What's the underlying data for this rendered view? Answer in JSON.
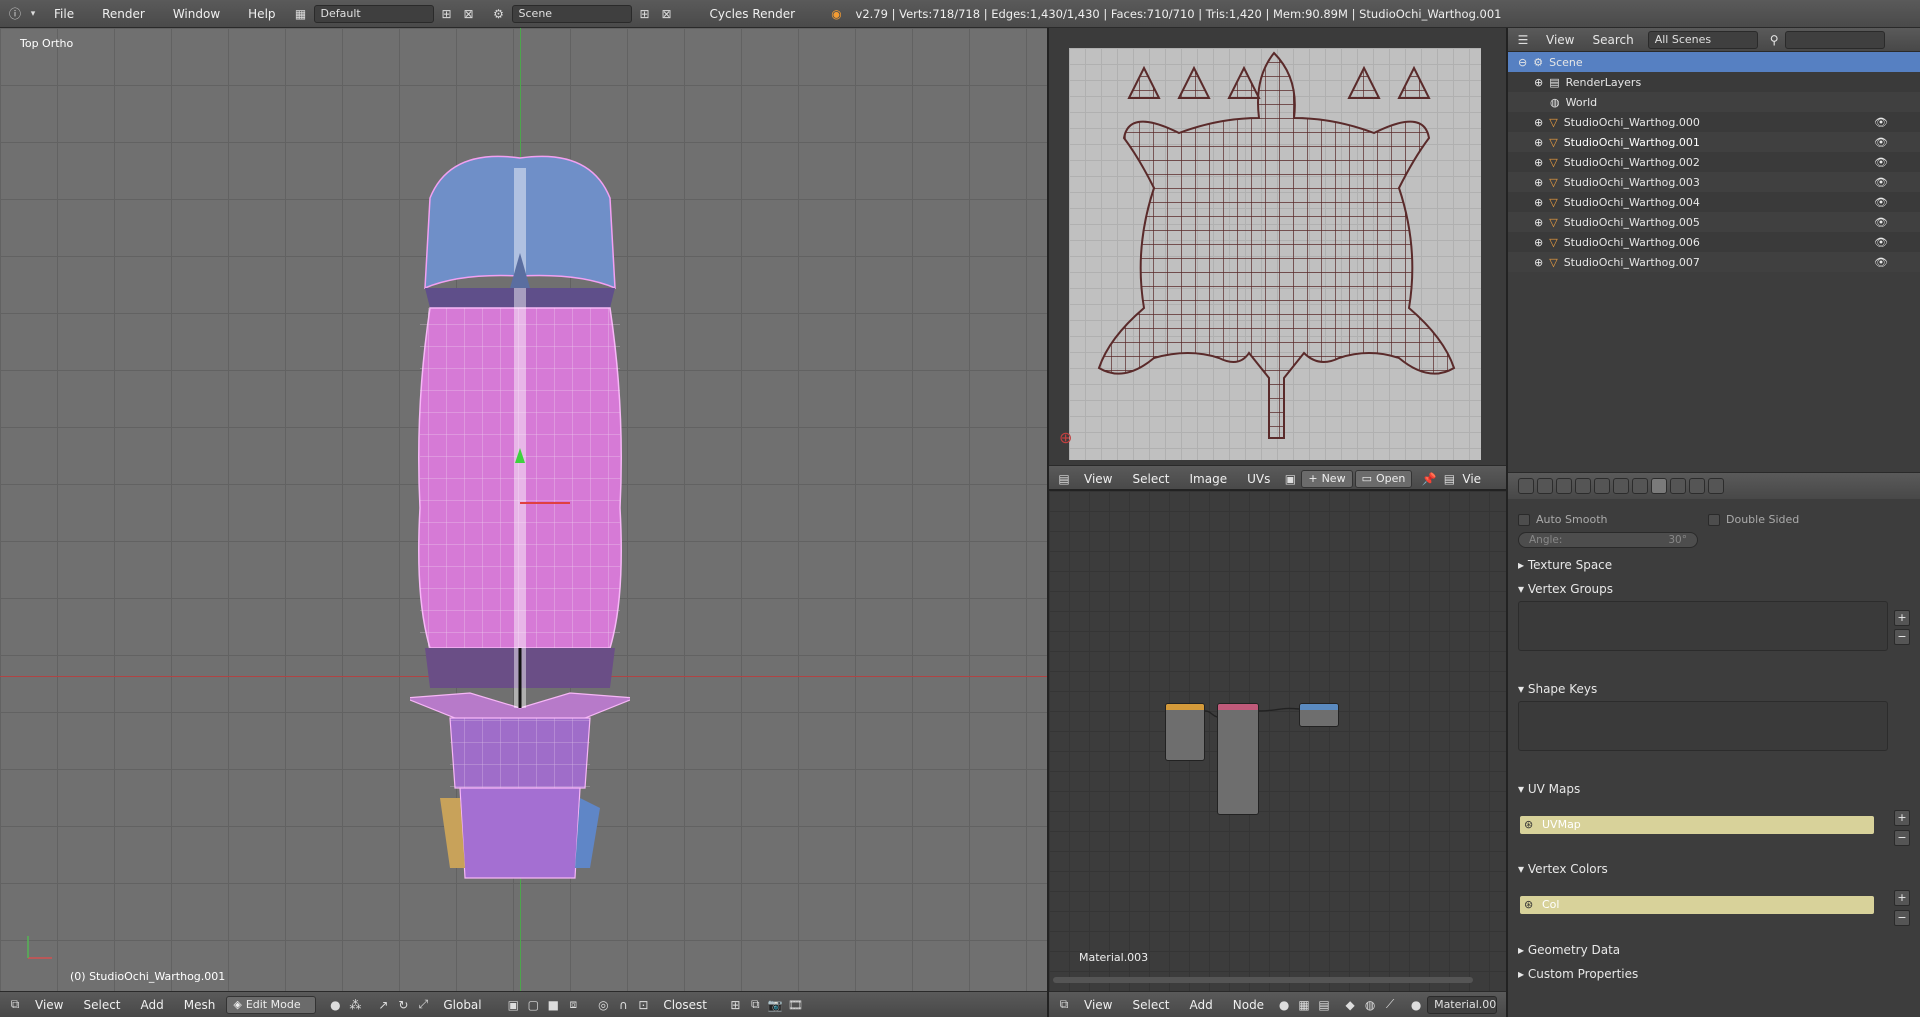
{
  "topbar": {
    "menus": [
      "File",
      "Render",
      "Window",
      "Help"
    ],
    "layout": "Default",
    "scene": "Scene",
    "engine": "Cycles Render",
    "stats": "v2.79 | Verts:718/718 | Edges:1,430/1,430 | Faces:710/710 | Tris:1,420 | Mem:90.89M | StudioOchi_Warthog.001"
  },
  "viewport": {
    "view_label": "Top Ortho",
    "object_label": "(0) StudioOchi_Warthog.001",
    "header": {
      "menus": [
        "View",
        "Select",
        "Add",
        "Mesh"
      ],
      "mode": "Edit Mode",
      "orientation": "Global",
      "snap": "Closest"
    }
  },
  "uv_editor": {
    "menus": [
      "View",
      "Select",
      "Image",
      "UVs"
    ],
    "new_label": "New",
    "open_label": "Open",
    "truncated_label": "Vie"
  },
  "node_editor": {
    "material_label": "Material.003",
    "menus": [
      "View",
      "Select",
      "Add",
      "Node"
    ],
    "material_field": "Material.00"
  },
  "outliner": {
    "header_menus": [
      "View",
      "Search"
    ],
    "display": "All Scenes",
    "search_placeholder": "",
    "rows": [
      {
        "label": "Scene",
        "indent": 0,
        "selected": true
      },
      {
        "label": "RenderLayers",
        "indent": 1
      },
      {
        "label": "World",
        "indent": 1
      },
      {
        "label": "StudioOchi_Warthog.000",
        "indent": 1
      },
      {
        "label": "StudioOchi_Warthog.001",
        "indent": 1,
        "active": true
      },
      {
        "label": "StudioOchi_Warthog.002",
        "indent": 1
      },
      {
        "label": "StudioOchi_Warthog.003",
        "indent": 1
      },
      {
        "label": "StudioOchi_Warthog.004",
        "indent": 1
      },
      {
        "label": "StudioOchi_Warthog.005",
        "indent": 1
      },
      {
        "label": "StudioOchi_Warthog.006",
        "indent": 1
      },
      {
        "label": "StudioOchi_Warthog.007",
        "indent": 1
      }
    ]
  },
  "properties": {
    "auto_smooth": "Auto Smooth",
    "double_sided": "Double Sided",
    "angle_label": "Angle:",
    "angle_value": "30°",
    "panels": {
      "texture_space": "Texture Space",
      "vertex_groups": "Vertex Groups",
      "shape_keys": "Shape Keys",
      "uv_maps": "UV Maps",
      "vertex_colors": "Vertex Colors",
      "geometry_data": "Geometry Data",
      "custom_properties": "Custom Properties"
    },
    "uv_map_name": "UVMap",
    "vertex_color_name": "Col"
  },
  "colors": {
    "accent_select": "#5680c2",
    "list_highlight": "#d8d29a",
    "mesh_pink": "#d67ad6"
  }
}
